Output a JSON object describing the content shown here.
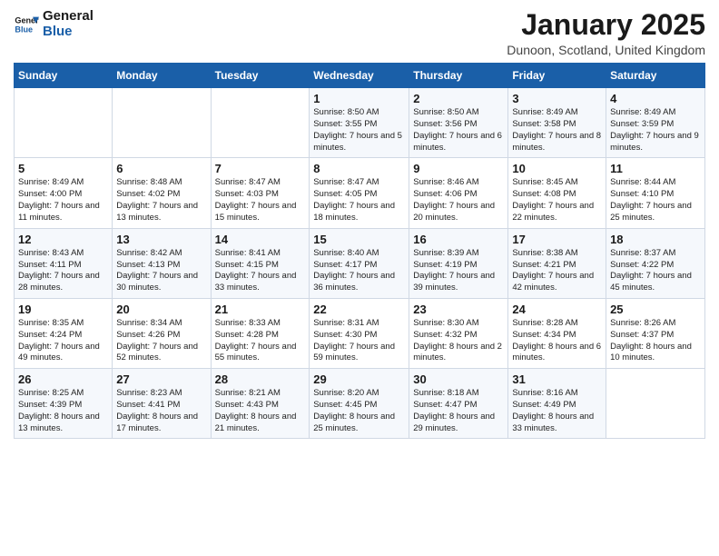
{
  "header": {
    "logo_general": "General",
    "logo_blue": "Blue",
    "month_title": "January 2025",
    "location": "Dunoon, Scotland, United Kingdom"
  },
  "weekdays": [
    "Sunday",
    "Monday",
    "Tuesday",
    "Wednesday",
    "Thursday",
    "Friday",
    "Saturday"
  ],
  "weeks": [
    [
      {
        "day": "",
        "info": ""
      },
      {
        "day": "",
        "info": ""
      },
      {
        "day": "",
        "info": ""
      },
      {
        "day": "1",
        "info": "Sunrise: 8:50 AM\nSunset: 3:55 PM\nDaylight: 7 hours\nand 5 minutes."
      },
      {
        "day": "2",
        "info": "Sunrise: 8:50 AM\nSunset: 3:56 PM\nDaylight: 7 hours\nand 6 minutes."
      },
      {
        "day": "3",
        "info": "Sunrise: 8:49 AM\nSunset: 3:58 PM\nDaylight: 7 hours\nand 8 minutes."
      },
      {
        "day": "4",
        "info": "Sunrise: 8:49 AM\nSunset: 3:59 PM\nDaylight: 7 hours\nand 9 minutes."
      }
    ],
    [
      {
        "day": "5",
        "info": "Sunrise: 8:49 AM\nSunset: 4:00 PM\nDaylight: 7 hours\nand 11 minutes."
      },
      {
        "day": "6",
        "info": "Sunrise: 8:48 AM\nSunset: 4:02 PM\nDaylight: 7 hours\nand 13 minutes."
      },
      {
        "day": "7",
        "info": "Sunrise: 8:47 AM\nSunset: 4:03 PM\nDaylight: 7 hours\nand 15 minutes."
      },
      {
        "day": "8",
        "info": "Sunrise: 8:47 AM\nSunset: 4:05 PM\nDaylight: 7 hours\nand 18 minutes."
      },
      {
        "day": "9",
        "info": "Sunrise: 8:46 AM\nSunset: 4:06 PM\nDaylight: 7 hours\nand 20 minutes."
      },
      {
        "day": "10",
        "info": "Sunrise: 8:45 AM\nSunset: 4:08 PM\nDaylight: 7 hours\nand 22 minutes."
      },
      {
        "day": "11",
        "info": "Sunrise: 8:44 AM\nSunset: 4:10 PM\nDaylight: 7 hours\nand 25 minutes."
      }
    ],
    [
      {
        "day": "12",
        "info": "Sunrise: 8:43 AM\nSunset: 4:11 PM\nDaylight: 7 hours\nand 28 minutes."
      },
      {
        "day": "13",
        "info": "Sunrise: 8:42 AM\nSunset: 4:13 PM\nDaylight: 7 hours\nand 30 minutes."
      },
      {
        "day": "14",
        "info": "Sunrise: 8:41 AM\nSunset: 4:15 PM\nDaylight: 7 hours\nand 33 minutes."
      },
      {
        "day": "15",
        "info": "Sunrise: 8:40 AM\nSunset: 4:17 PM\nDaylight: 7 hours\nand 36 minutes."
      },
      {
        "day": "16",
        "info": "Sunrise: 8:39 AM\nSunset: 4:19 PM\nDaylight: 7 hours\nand 39 minutes."
      },
      {
        "day": "17",
        "info": "Sunrise: 8:38 AM\nSunset: 4:21 PM\nDaylight: 7 hours\nand 42 minutes."
      },
      {
        "day": "18",
        "info": "Sunrise: 8:37 AM\nSunset: 4:22 PM\nDaylight: 7 hours\nand 45 minutes."
      }
    ],
    [
      {
        "day": "19",
        "info": "Sunrise: 8:35 AM\nSunset: 4:24 PM\nDaylight: 7 hours\nand 49 minutes."
      },
      {
        "day": "20",
        "info": "Sunrise: 8:34 AM\nSunset: 4:26 PM\nDaylight: 7 hours\nand 52 minutes."
      },
      {
        "day": "21",
        "info": "Sunrise: 8:33 AM\nSunset: 4:28 PM\nDaylight: 7 hours\nand 55 minutes."
      },
      {
        "day": "22",
        "info": "Sunrise: 8:31 AM\nSunset: 4:30 PM\nDaylight: 7 hours\nand 59 minutes."
      },
      {
        "day": "23",
        "info": "Sunrise: 8:30 AM\nSunset: 4:32 PM\nDaylight: 8 hours\nand 2 minutes."
      },
      {
        "day": "24",
        "info": "Sunrise: 8:28 AM\nSunset: 4:34 PM\nDaylight: 8 hours\nand 6 minutes."
      },
      {
        "day": "25",
        "info": "Sunrise: 8:26 AM\nSunset: 4:37 PM\nDaylight: 8 hours\nand 10 minutes."
      }
    ],
    [
      {
        "day": "26",
        "info": "Sunrise: 8:25 AM\nSunset: 4:39 PM\nDaylight: 8 hours\nand 13 minutes."
      },
      {
        "day": "27",
        "info": "Sunrise: 8:23 AM\nSunset: 4:41 PM\nDaylight: 8 hours\nand 17 minutes."
      },
      {
        "day": "28",
        "info": "Sunrise: 8:21 AM\nSunset: 4:43 PM\nDaylight: 8 hours\nand 21 minutes."
      },
      {
        "day": "29",
        "info": "Sunrise: 8:20 AM\nSunset: 4:45 PM\nDaylight: 8 hours\nand 25 minutes."
      },
      {
        "day": "30",
        "info": "Sunrise: 8:18 AM\nSunset: 4:47 PM\nDaylight: 8 hours\nand 29 minutes."
      },
      {
        "day": "31",
        "info": "Sunrise: 8:16 AM\nSunset: 4:49 PM\nDaylight: 8 hours\nand 33 minutes."
      },
      {
        "day": "",
        "info": ""
      }
    ]
  ]
}
